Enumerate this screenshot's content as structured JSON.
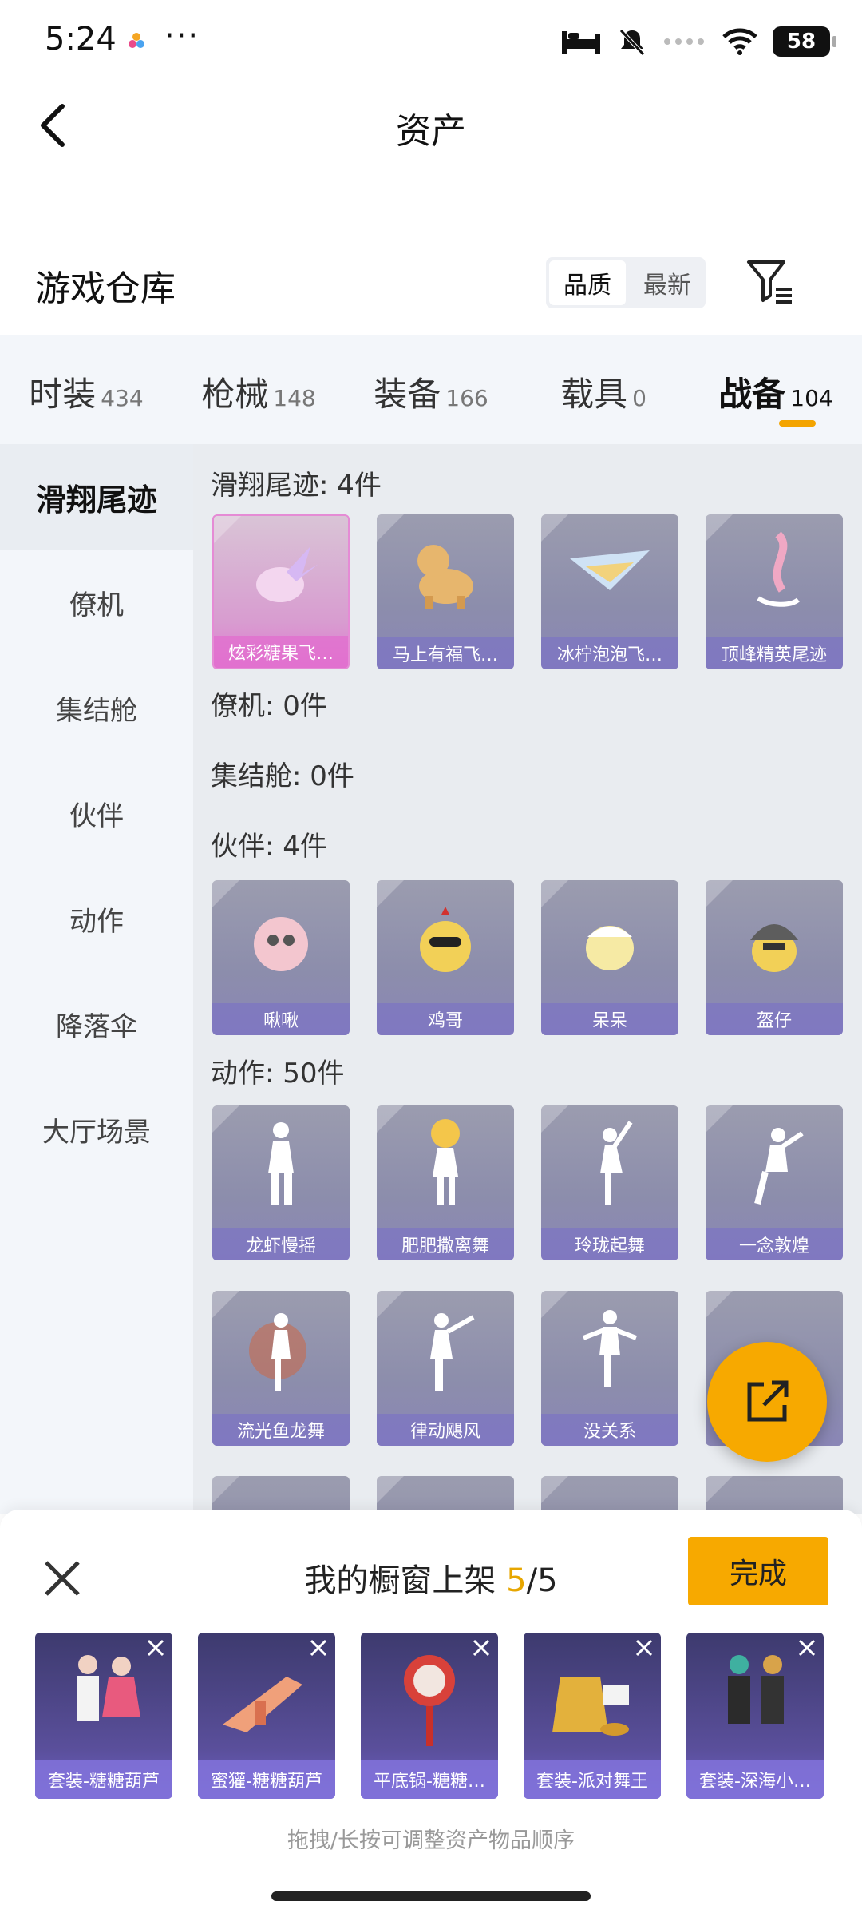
{
  "status_bar": {
    "time": "5:24",
    "more": "···",
    "battery": "58"
  },
  "header": {
    "title": "资产"
  },
  "warehouse": {
    "title": "游戏仓库",
    "sort_options": [
      "品质",
      "最新"
    ]
  },
  "category_tabs": [
    {
      "label": "时装",
      "count": "434"
    },
    {
      "label": "枪械",
      "count": "148"
    },
    {
      "label": "装备",
      "count": "166"
    },
    {
      "label": "载具",
      "count": "0"
    },
    {
      "label": "战备",
      "count": "104"
    }
  ],
  "sidebar": {
    "items": [
      "滑翔尾迹",
      "僚机",
      "集结舱",
      "伙伴",
      "动作",
      "降落伞",
      "大厅场景"
    ]
  },
  "sections": {
    "trail": {
      "label": "滑翔尾迹: 4件",
      "items": [
        "炫彩糖果飞…",
        "马上有福飞…",
        "冰柠泡泡飞…",
        "顶峰精英尾迹"
      ]
    },
    "wingman": {
      "label": "僚机: 0件"
    },
    "pod": {
      "label": "集结舱: 0件"
    },
    "partner": {
      "label": "伙伴: 4件",
      "items": [
        "啾啾",
        "鸡哥",
        "呆呆",
        "盔仔"
      ]
    },
    "emote": {
      "label": "动作: 50件",
      "items": [
        "龙虾慢摇",
        "肥肥撒离舞",
        "玲珑起舞",
        "一念敦煌",
        "流光鱼龙舞",
        "律动飓风",
        "没关系"
      ]
    }
  },
  "panel": {
    "title_prefix": "我的橱窗上架",
    "count_current": "5",
    "count_total": "/5",
    "done_label": "完成",
    "items": [
      "套装-糖糖葫芦",
      "蜜獾-糖糖葫芦",
      "平底锅-糖糖…",
      "套装-派对舞王",
      "套装-深海小…"
    ],
    "hint": "拖拽/长按可调整资产物品顺序"
  },
  "colors": {
    "accent": "#f7a900",
    "card_purple": "#8c8dac",
    "card_pink": "#e07ad2"
  },
  "icons": {
    "back": "chevron-left-icon",
    "filter": "filter-icon",
    "share": "share-icon",
    "close": "close-icon"
  }
}
